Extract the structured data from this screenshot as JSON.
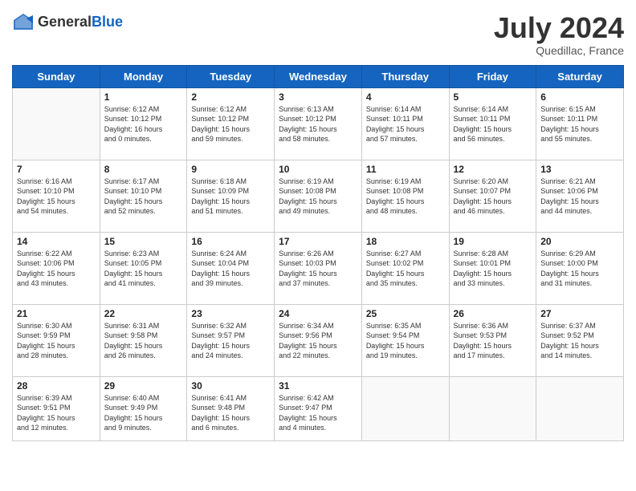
{
  "header": {
    "logo_general": "General",
    "logo_blue": "Blue",
    "month_title": "July 2024",
    "location": "Quedillac, France"
  },
  "days_of_week": [
    "Sunday",
    "Monday",
    "Tuesday",
    "Wednesday",
    "Thursday",
    "Friday",
    "Saturday"
  ],
  "weeks": [
    [
      {
        "day": "",
        "info": ""
      },
      {
        "day": "1",
        "info": "Sunrise: 6:12 AM\nSunset: 10:12 PM\nDaylight: 16 hours\nand 0 minutes."
      },
      {
        "day": "2",
        "info": "Sunrise: 6:12 AM\nSunset: 10:12 PM\nDaylight: 15 hours\nand 59 minutes."
      },
      {
        "day": "3",
        "info": "Sunrise: 6:13 AM\nSunset: 10:12 PM\nDaylight: 15 hours\nand 58 minutes."
      },
      {
        "day": "4",
        "info": "Sunrise: 6:14 AM\nSunset: 10:11 PM\nDaylight: 15 hours\nand 57 minutes."
      },
      {
        "day": "5",
        "info": "Sunrise: 6:14 AM\nSunset: 10:11 PM\nDaylight: 15 hours\nand 56 minutes."
      },
      {
        "day": "6",
        "info": "Sunrise: 6:15 AM\nSunset: 10:11 PM\nDaylight: 15 hours\nand 55 minutes."
      }
    ],
    [
      {
        "day": "7",
        "info": "Sunrise: 6:16 AM\nSunset: 10:10 PM\nDaylight: 15 hours\nand 54 minutes."
      },
      {
        "day": "8",
        "info": "Sunrise: 6:17 AM\nSunset: 10:10 PM\nDaylight: 15 hours\nand 52 minutes."
      },
      {
        "day": "9",
        "info": "Sunrise: 6:18 AM\nSunset: 10:09 PM\nDaylight: 15 hours\nand 51 minutes."
      },
      {
        "day": "10",
        "info": "Sunrise: 6:19 AM\nSunset: 10:08 PM\nDaylight: 15 hours\nand 49 minutes."
      },
      {
        "day": "11",
        "info": "Sunrise: 6:19 AM\nSunset: 10:08 PM\nDaylight: 15 hours\nand 48 minutes."
      },
      {
        "day": "12",
        "info": "Sunrise: 6:20 AM\nSunset: 10:07 PM\nDaylight: 15 hours\nand 46 minutes."
      },
      {
        "day": "13",
        "info": "Sunrise: 6:21 AM\nSunset: 10:06 PM\nDaylight: 15 hours\nand 44 minutes."
      }
    ],
    [
      {
        "day": "14",
        "info": "Sunrise: 6:22 AM\nSunset: 10:06 PM\nDaylight: 15 hours\nand 43 minutes."
      },
      {
        "day": "15",
        "info": "Sunrise: 6:23 AM\nSunset: 10:05 PM\nDaylight: 15 hours\nand 41 minutes."
      },
      {
        "day": "16",
        "info": "Sunrise: 6:24 AM\nSunset: 10:04 PM\nDaylight: 15 hours\nand 39 minutes."
      },
      {
        "day": "17",
        "info": "Sunrise: 6:26 AM\nSunset: 10:03 PM\nDaylight: 15 hours\nand 37 minutes."
      },
      {
        "day": "18",
        "info": "Sunrise: 6:27 AM\nSunset: 10:02 PM\nDaylight: 15 hours\nand 35 minutes."
      },
      {
        "day": "19",
        "info": "Sunrise: 6:28 AM\nSunset: 10:01 PM\nDaylight: 15 hours\nand 33 minutes."
      },
      {
        "day": "20",
        "info": "Sunrise: 6:29 AM\nSunset: 10:00 PM\nDaylight: 15 hours\nand 31 minutes."
      }
    ],
    [
      {
        "day": "21",
        "info": "Sunrise: 6:30 AM\nSunset: 9:59 PM\nDaylight: 15 hours\nand 28 minutes."
      },
      {
        "day": "22",
        "info": "Sunrise: 6:31 AM\nSunset: 9:58 PM\nDaylight: 15 hours\nand 26 minutes."
      },
      {
        "day": "23",
        "info": "Sunrise: 6:32 AM\nSunset: 9:57 PM\nDaylight: 15 hours\nand 24 minutes."
      },
      {
        "day": "24",
        "info": "Sunrise: 6:34 AM\nSunset: 9:56 PM\nDaylight: 15 hours\nand 22 minutes."
      },
      {
        "day": "25",
        "info": "Sunrise: 6:35 AM\nSunset: 9:54 PM\nDaylight: 15 hours\nand 19 minutes."
      },
      {
        "day": "26",
        "info": "Sunrise: 6:36 AM\nSunset: 9:53 PM\nDaylight: 15 hours\nand 17 minutes."
      },
      {
        "day": "27",
        "info": "Sunrise: 6:37 AM\nSunset: 9:52 PM\nDaylight: 15 hours\nand 14 minutes."
      }
    ],
    [
      {
        "day": "28",
        "info": "Sunrise: 6:39 AM\nSunset: 9:51 PM\nDaylight: 15 hours\nand 12 minutes."
      },
      {
        "day": "29",
        "info": "Sunrise: 6:40 AM\nSunset: 9:49 PM\nDaylight: 15 hours\nand 9 minutes."
      },
      {
        "day": "30",
        "info": "Sunrise: 6:41 AM\nSunset: 9:48 PM\nDaylight: 15 hours\nand 6 minutes."
      },
      {
        "day": "31",
        "info": "Sunrise: 6:42 AM\nSunset: 9:47 PM\nDaylight: 15 hours\nand 4 minutes."
      },
      {
        "day": "",
        "info": ""
      },
      {
        "day": "",
        "info": ""
      },
      {
        "day": "",
        "info": ""
      }
    ]
  ]
}
